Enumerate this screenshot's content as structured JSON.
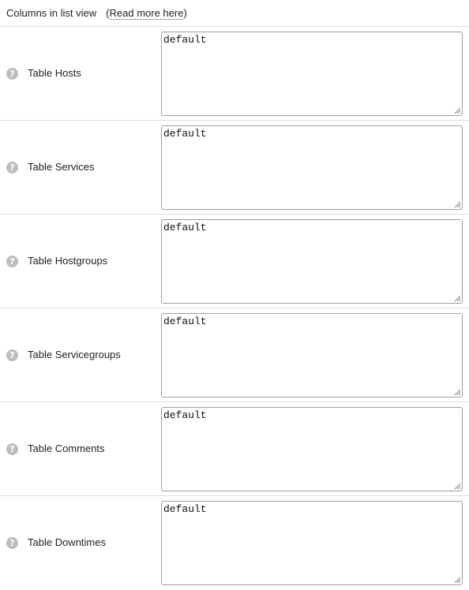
{
  "header": {
    "title": "Columns in list view",
    "read_more_open": "(",
    "read_more_label": "Read more here",
    "read_more_close": ")"
  },
  "help_icon_glyph": "?",
  "rows": [
    {
      "label": "Table Hosts",
      "value": "default"
    },
    {
      "label": "Table Services",
      "value": "default"
    },
    {
      "label": "Table Hostgroups",
      "value": "default"
    },
    {
      "label": "Table Servicegroups",
      "value": "default"
    },
    {
      "label": "Table Comments",
      "value": "default"
    },
    {
      "label": "Table Downtimes",
      "value": "default"
    }
  ],
  "colors": {
    "border": "#dddddd",
    "help_icon_bg": "#bdbdbd",
    "text": "#222222"
  }
}
